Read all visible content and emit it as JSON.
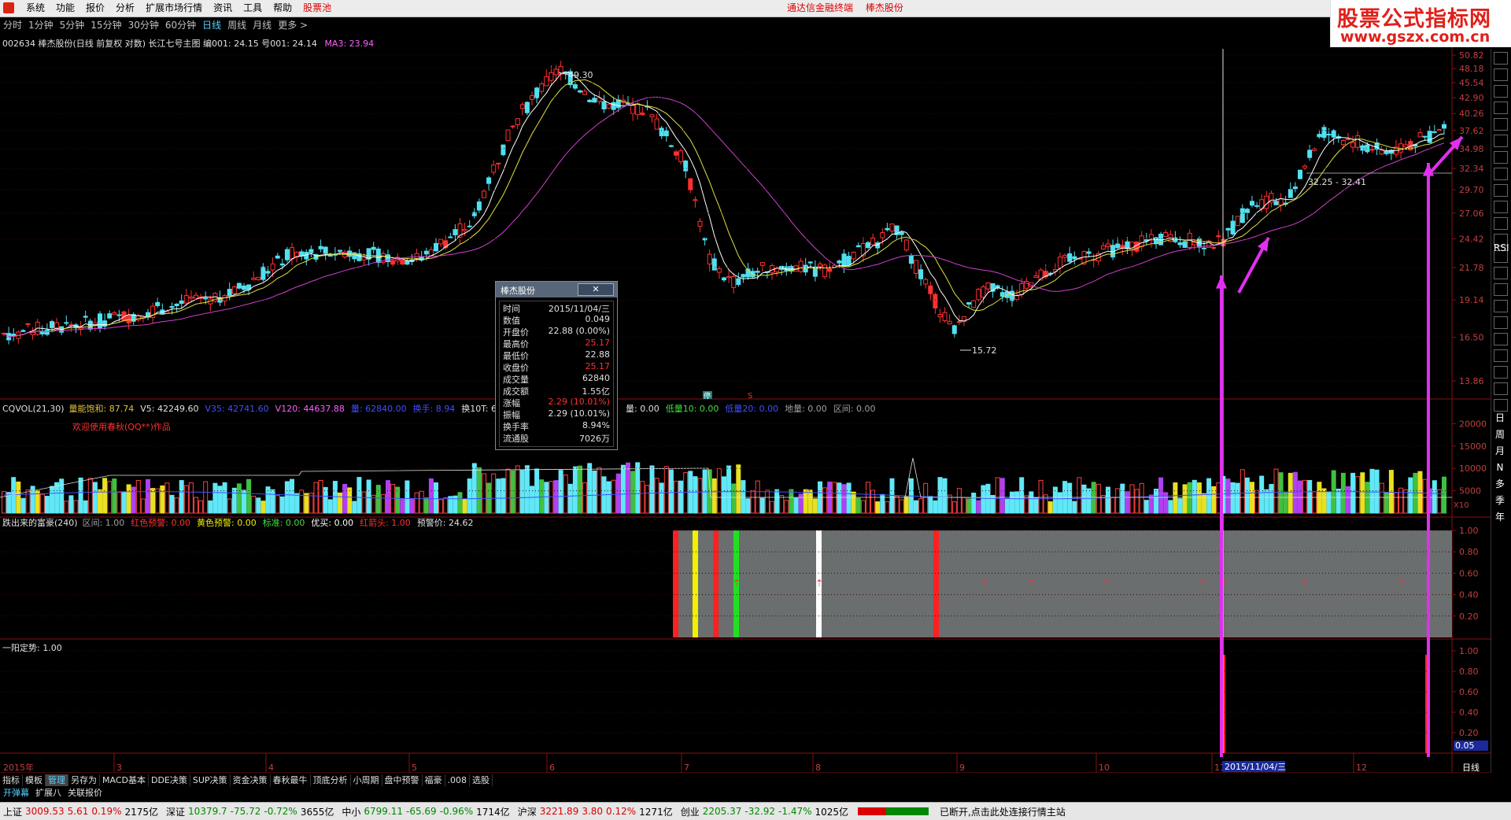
{
  "window": {
    "title": "通达信金融终端",
    "stock_title": "棒杰股份",
    "menus": [
      "系统",
      "功能",
      "报价",
      "分析",
      "扩展市场行情",
      "资讯",
      "工具",
      "帮助",
      "股票池"
    ],
    "active_menu_index": 8
  },
  "watermark": {
    "line1": "股票公式指标网",
    "line2": "www.gszx.com.cn"
  },
  "periods": {
    "items": [
      "分时",
      "1分钟",
      "5分钟",
      "15分钟",
      "30分钟",
      "60分钟",
      "日线",
      "周线",
      "月线",
      "更多 >"
    ],
    "selected_index": 6
  },
  "main_chart": {
    "header": "002634 棒杰股份(日线 前复权 对数) 长江七号主图 编001: 24.15 号001: 24.14",
    "ma3_label": "MA3: 23.94",
    "price_axis": [
      "50.82",
      "48.18",
      "45.54",
      "42.90",
      "40.26",
      "37.62",
      "34.98",
      "32.34",
      "29.70",
      "27.06",
      "24.42",
      "21.78",
      "19.14",
      "16.50",
      "13.86"
    ],
    "high_label": "49.30",
    "low_label": "15.72",
    "range_label": "32.25 - 32.41",
    "mark_ting": "停",
    "mark_s": "S"
  },
  "volume_chart": {
    "name": "CQVOL(21,30)",
    "items": [
      {
        "text": "量能饱和: 87.74",
        "color": "#e0c040"
      },
      {
        "text": "V5: 42249.60",
        "color": "#e0e0e0"
      },
      {
        "text": "V35: 42741.60",
        "color": "#4050ff"
      },
      {
        "text": "V120: 44637.88",
        "color": "#ff60ff"
      },
      {
        "text": "量: 62840.00",
        "color": "#4050ff"
      },
      {
        "text": "换手: 8.94",
        "color": "#4050ff"
      },
      {
        "text": "换10T: 6",
        "color": "#e0e0e0"
      }
    ],
    "items2": [
      {
        "text": "量: 0.00",
        "color": "#e0e0e0"
      },
      {
        "text": "低量10: 0.00",
        "color": "#40e040"
      },
      {
        "text": "低量20: 0.00",
        "color": "#4050ff"
      },
      {
        "text": "地量: 0.00",
        "color": "#a0a0a0"
      },
      {
        "text": "区间: 0.00",
        "color": "#a0a0a0"
      }
    ],
    "welcome": "欢迎使用春秋(QQ**)作品",
    "axis": [
      "20000",
      "15000",
      "10000",
      "5000"
    ],
    "unit": "X10"
  },
  "signal_chart": {
    "name": "跌出来的富豪(240)",
    "items": [
      {
        "text": "区间: 1.00",
        "color": "#a0a0a0"
      },
      {
        "text": "红色预警: 0.00",
        "color": "#ff3030"
      },
      {
        "text": "黄色预警: 0.00",
        "color": "#f0f000"
      },
      {
        "text": "标准: 0.00",
        "color": "#40e040"
      },
      {
        "text": "优买: 0.00",
        "color": "#ffffff"
      },
      {
        "text": "红箭头: 1.00",
        "color": "#ff3030"
      },
      {
        "text": "预警价: 24.62",
        "color": "#e0e0e0"
      }
    ],
    "axis": [
      "1.00",
      "0.80",
      "0.60",
      "0.40",
      "0.20"
    ]
  },
  "trend_chart": {
    "name": "一阳定势: 1.00",
    "axis": [
      "1.00",
      "0.80",
      "0.60",
      "0.40",
      "0.20"
    ],
    "current": "0.05"
  },
  "date_axis": {
    "year": "2015年",
    "months": [
      "3",
      "4",
      "5",
      "6",
      "7",
      "8",
      "9",
      "10",
      "11",
      "12"
    ],
    "cursor_date": "2015/11/04/三",
    "period_label": "日线"
  },
  "popup": {
    "title": "棒杰股份",
    "close": "✕",
    "rows": [
      {
        "k": "时间",
        "v": "2015/11/04/三",
        "c": "#e0e0e0"
      },
      {
        "k": "数值",
        "v": "0.049",
        "c": "#e0e0e0"
      },
      {
        "k": "开盘价",
        "v": "22.88 (0.00%)",
        "c": "#e0e0e0"
      },
      {
        "k": "最高价",
        "v": "25.17",
        "c": "#ff3030"
      },
      {
        "k": "最低价",
        "v": "22.88",
        "c": "#e0e0e0"
      },
      {
        "k": "收盘价",
        "v": "25.17",
        "c": "#ff3030"
      },
      {
        "k": "成交量",
        "v": "62840",
        "c": "#e0e0e0"
      },
      {
        "k": "成交额",
        "v": "1.55亿",
        "c": "#e0e0e0"
      },
      {
        "k": "涨幅",
        "v": "2.29 (10.01%)",
        "c": "#ff3030"
      },
      {
        "k": "振幅",
        "v": "2.29 (10.01%)",
        "c": "#e0e0e0"
      },
      {
        "k": "换手率",
        "v": "8.94%",
        "c": "#e0e0e0"
      },
      {
        "k": "流通股",
        "v": "7026万",
        "c": "#e0e0e0"
      }
    ]
  },
  "bottom_tabs": [
    "指标",
    "模板",
    "管理",
    "另存为",
    "MACD基本",
    "DDE决策",
    "SUP决策",
    "资金决策",
    "春秋最牛",
    "顶底分析",
    "小周期",
    "盘中预警",
    "福豪",
    ".008",
    "选股"
  ],
  "bottom_tabs_selected": 2,
  "bottom_tabs2": [
    "开弹幕",
    "扩展八",
    "关联报价"
  ],
  "right_toolbar_labels": [
    "RSI",
    "日",
    "周",
    "月",
    "N",
    "多",
    "季",
    "年"
  ],
  "status": {
    "items": [
      {
        "text": "上证",
        "color": "#000"
      },
      {
        "text": "3009.53",
        "color": "#d00"
      },
      {
        "text": "5.61",
        "color": "#d00"
      },
      {
        "text": "0.19%",
        "color": "#d00"
      },
      {
        "text": "2175亿",
        "color": "#000"
      },
      {
        "text": "深证",
        "color": "#000"
      },
      {
        "text": "10379.7",
        "color": "#080"
      },
      {
        "text": "-75.72",
        "color": "#080"
      },
      {
        "text": "-0.72%",
        "color": "#080"
      },
      {
        "text": "3655亿",
        "color": "#000"
      },
      {
        "text": "中小",
        "color": "#000"
      },
      {
        "text": "6799.11",
        "color": "#080"
      },
      {
        "text": "-65.69",
        "color": "#080"
      },
      {
        "text": "-0.96%",
        "color": "#080"
      },
      {
        "text": "1714亿",
        "color": "#000"
      },
      {
        "text": "沪深",
        "color": "#000"
      },
      {
        "text": "3221.89",
        "color": "#d00"
      },
      {
        "text": "3.80",
        "color": "#d00"
      },
      {
        "text": "0.12%",
        "color": "#d00"
      },
      {
        "text": "1271亿",
        "color": "#000"
      },
      {
        "text": "创业",
        "color": "#000"
      },
      {
        "text": "2205.37",
        "color": "#080"
      },
      {
        "text": "-32.92",
        "color": "#080"
      },
      {
        "text": "-1.47%",
        "color": "#080"
      },
      {
        "text": "1025亿",
        "color": "#000"
      }
    ],
    "notice": "已断开,点击此处连接行情主站"
  }
}
